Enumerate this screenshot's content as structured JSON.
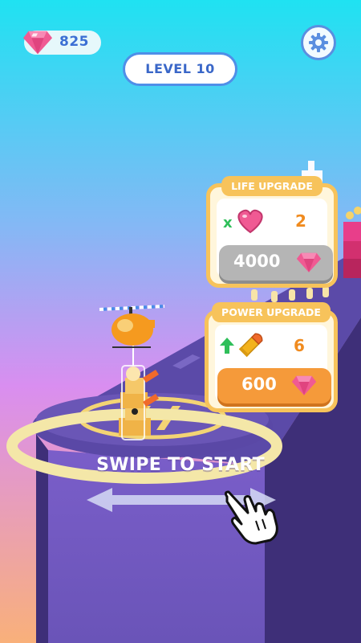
{
  "hud": {
    "gem_count": "825",
    "level_label": "LEVEL 10"
  },
  "upgrades": {
    "life": {
      "title": "LIFE UPGRADE",
      "multiplier": "x",
      "value": "2",
      "cost": "4000",
      "enabled": false
    },
    "power": {
      "title": "POWER UPGRADE",
      "value": "6",
      "cost": "600",
      "enabled": true
    }
  },
  "prompt": {
    "swipe_text": "SWIPE TO START"
  },
  "icons": {
    "gem": "gem-icon",
    "settings": "gear-icon",
    "heart": "heart-icon",
    "bullet": "bullet-icon",
    "arrow_up": "arrow-up-icon",
    "hand": "pointing-hand-icon",
    "swipe_arrow": "double-arrow-icon"
  },
  "colors": {
    "accent_blue": "#4f8fe8",
    "card_border": "#f7c35b",
    "value_orange": "#f08b1f",
    "button_orange": "#f59a3a",
    "button_disabled": "#b5b5b5",
    "gem_pink": "#f05a93"
  }
}
